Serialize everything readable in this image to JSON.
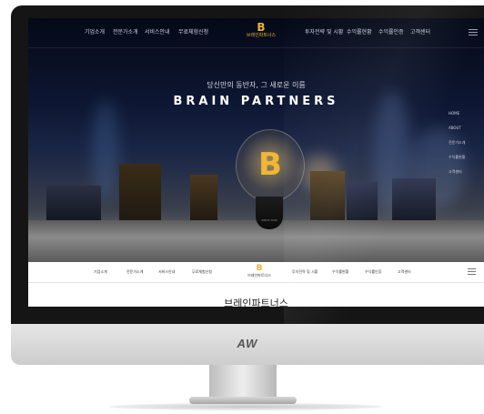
{
  "nav": {
    "left_items": [
      "기업소개",
      "전문가소개",
      "서비스안내",
      "무료체험신청"
    ],
    "right_items": [
      "투자전략 및 시황",
      "수익률현황",
      "수익률인증",
      "고객센터"
    ],
    "logo_text": "브레인파트너스"
  },
  "hero": {
    "tagline": "당신만의 동반자, 그 새로운 이름",
    "brand": "BRAIN PARTNERS",
    "bulb_glyph": "B",
    "bulb_base_text": "SINCE 2009",
    "side_nav": [
      "HOME",
      "ABOUT",
      "전문가소개",
      "수익률현황",
      "고객센터"
    ]
  },
  "subnav": {
    "left_items": [
      "기업소개",
      "전문가소개",
      "서비스안내",
      "무료체험신청"
    ],
    "right_items": [
      "투자전략 및 시황",
      "수익률현황",
      "수익률인증",
      "고객센터"
    ],
    "logo_text": "브레인파트너스"
  },
  "content": {
    "title": "브레인파트너스"
  },
  "monitor": {
    "chin_logo": "AW"
  },
  "colors": {
    "accent_gold": "#e7b23a",
    "hero_dark": "#0d1733"
  },
  "icons": {
    "menu": "hamburger-icon",
    "logo": "b-logo-icon"
  }
}
